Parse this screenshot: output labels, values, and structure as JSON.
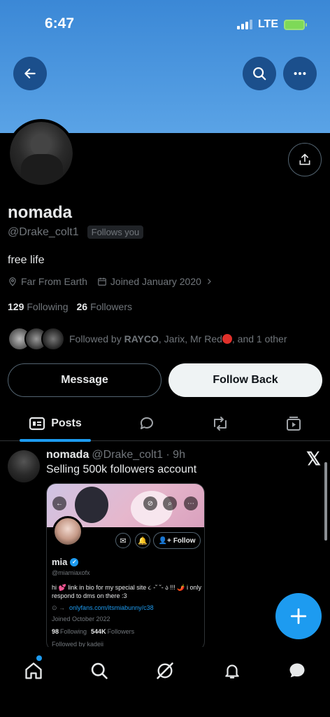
{
  "status_bar": {
    "time": "6:47",
    "network": "LTE"
  },
  "profile": {
    "name": "nomada",
    "handle": "@Drake_colt1",
    "follows_you_badge": "Follows you",
    "bio": "free life",
    "location": "Far From Earth",
    "joined": "Joined January 2020",
    "following_count": "129",
    "following_label": "Following",
    "followers_count": "26",
    "followers_label": "Followers",
    "followed_by_prefix": "Followed by",
    "followed_by_bold": "RAYCO",
    "followed_by_rest": ", Jarix, Mr Red",
    "followed_by_suffix": ", and 1 other"
  },
  "actions": {
    "message_label": "Message",
    "follow_back_label": "Follow Back"
  },
  "tabs": {
    "posts_label": "Posts"
  },
  "post": {
    "author_name": "nomada",
    "author_meta": "@Drake_colt1 · 9h",
    "text": "Selling 500k followers account",
    "embed": {
      "name": "mia",
      "handle": "@miamiaxofx",
      "follow_label": "Follow",
      "bio": "hi 💕 link in bio for my special site ૮ -˘ ˘- ა !!! 🌶️ i only respond to dms on there :3",
      "link_prefix": "⊙ →",
      "link": "onlyfans.com/itsmiabunny/c38",
      "joined": "Joined October 2022",
      "following_count": "98",
      "following_label": "Following",
      "followers_count": "544K",
      "followers_label": "Followers",
      "followed_by": "Followed by kadeii"
    }
  },
  "colors": {
    "accent": "#1d9bf0",
    "banner": "#4a96de",
    "background": "#000000"
  }
}
